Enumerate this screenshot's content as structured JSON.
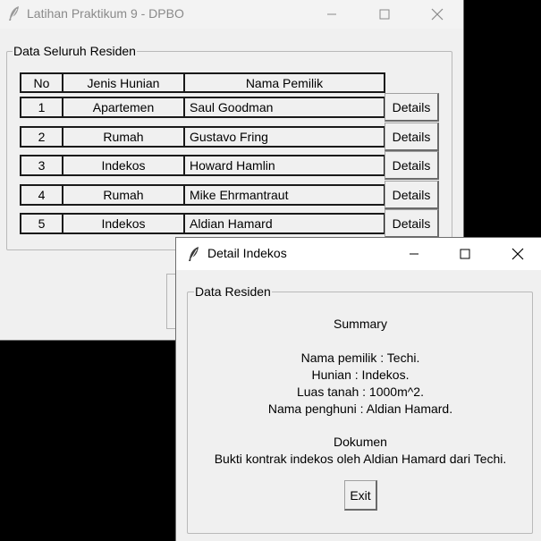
{
  "main_window": {
    "title": "Latihan Praktikum 9 - DPBO",
    "group_label": "Data Seluruh Residen",
    "columns": [
      "No",
      "Jenis Hunian",
      "Nama Pemilik"
    ],
    "rows": [
      {
        "no": "1",
        "jenis": "Apartemen",
        "nama": "Saul Goodman",
        "button": "Details"
      },
      {
        "no": "2",
        "jenis": "Rumah",
        "nama": "Gustavo Fring",
        "button": "Details"
      },
      {
        "no": "3",
        "jenis": "Indekos",
        "nama": "Howard Hamlin",
        "button": "Details"
      },
      {
        "no": "4",
        "jenis": "Rumah",
        "nama": "Mike Ehrmantraut",
        "button": "Details"
      },
      {
        "no": "5",
        "jenis": "Indekos",
        "nama": "Aldian Hamard",
        "button": "Details"
      }
    ]
  },
  "dialog": {
    "title": "Detail Indekos",
    "group_label": "Data Residen",
    "summary_heading": "Summary",
    "summary_lines": [
      "Nama pemilik : Techi.",
      "Hunian : Indekos.",
      "Luas tanah : 1000m^2.",
      "Nama penghuni : Aldian Hamard."
    ],
    "document_heading": "Dokumen",
    "document_line": "Bukti kontrak indekos oleh Aldian Hamard dari Techi.",
    "exit_label": "Exit"
  },
  "icons": {
    "app": "feather-icon",
    "minimize": "minimize-icon",
    "maximize": "maximize-icon",
    "close": "close-icon"
  },
  "colors": {
    "desktop": "#000000",
    "window_bg": "#f0f0f0",
    "inactive_title_text": "#8a8a8a"
  }
}
